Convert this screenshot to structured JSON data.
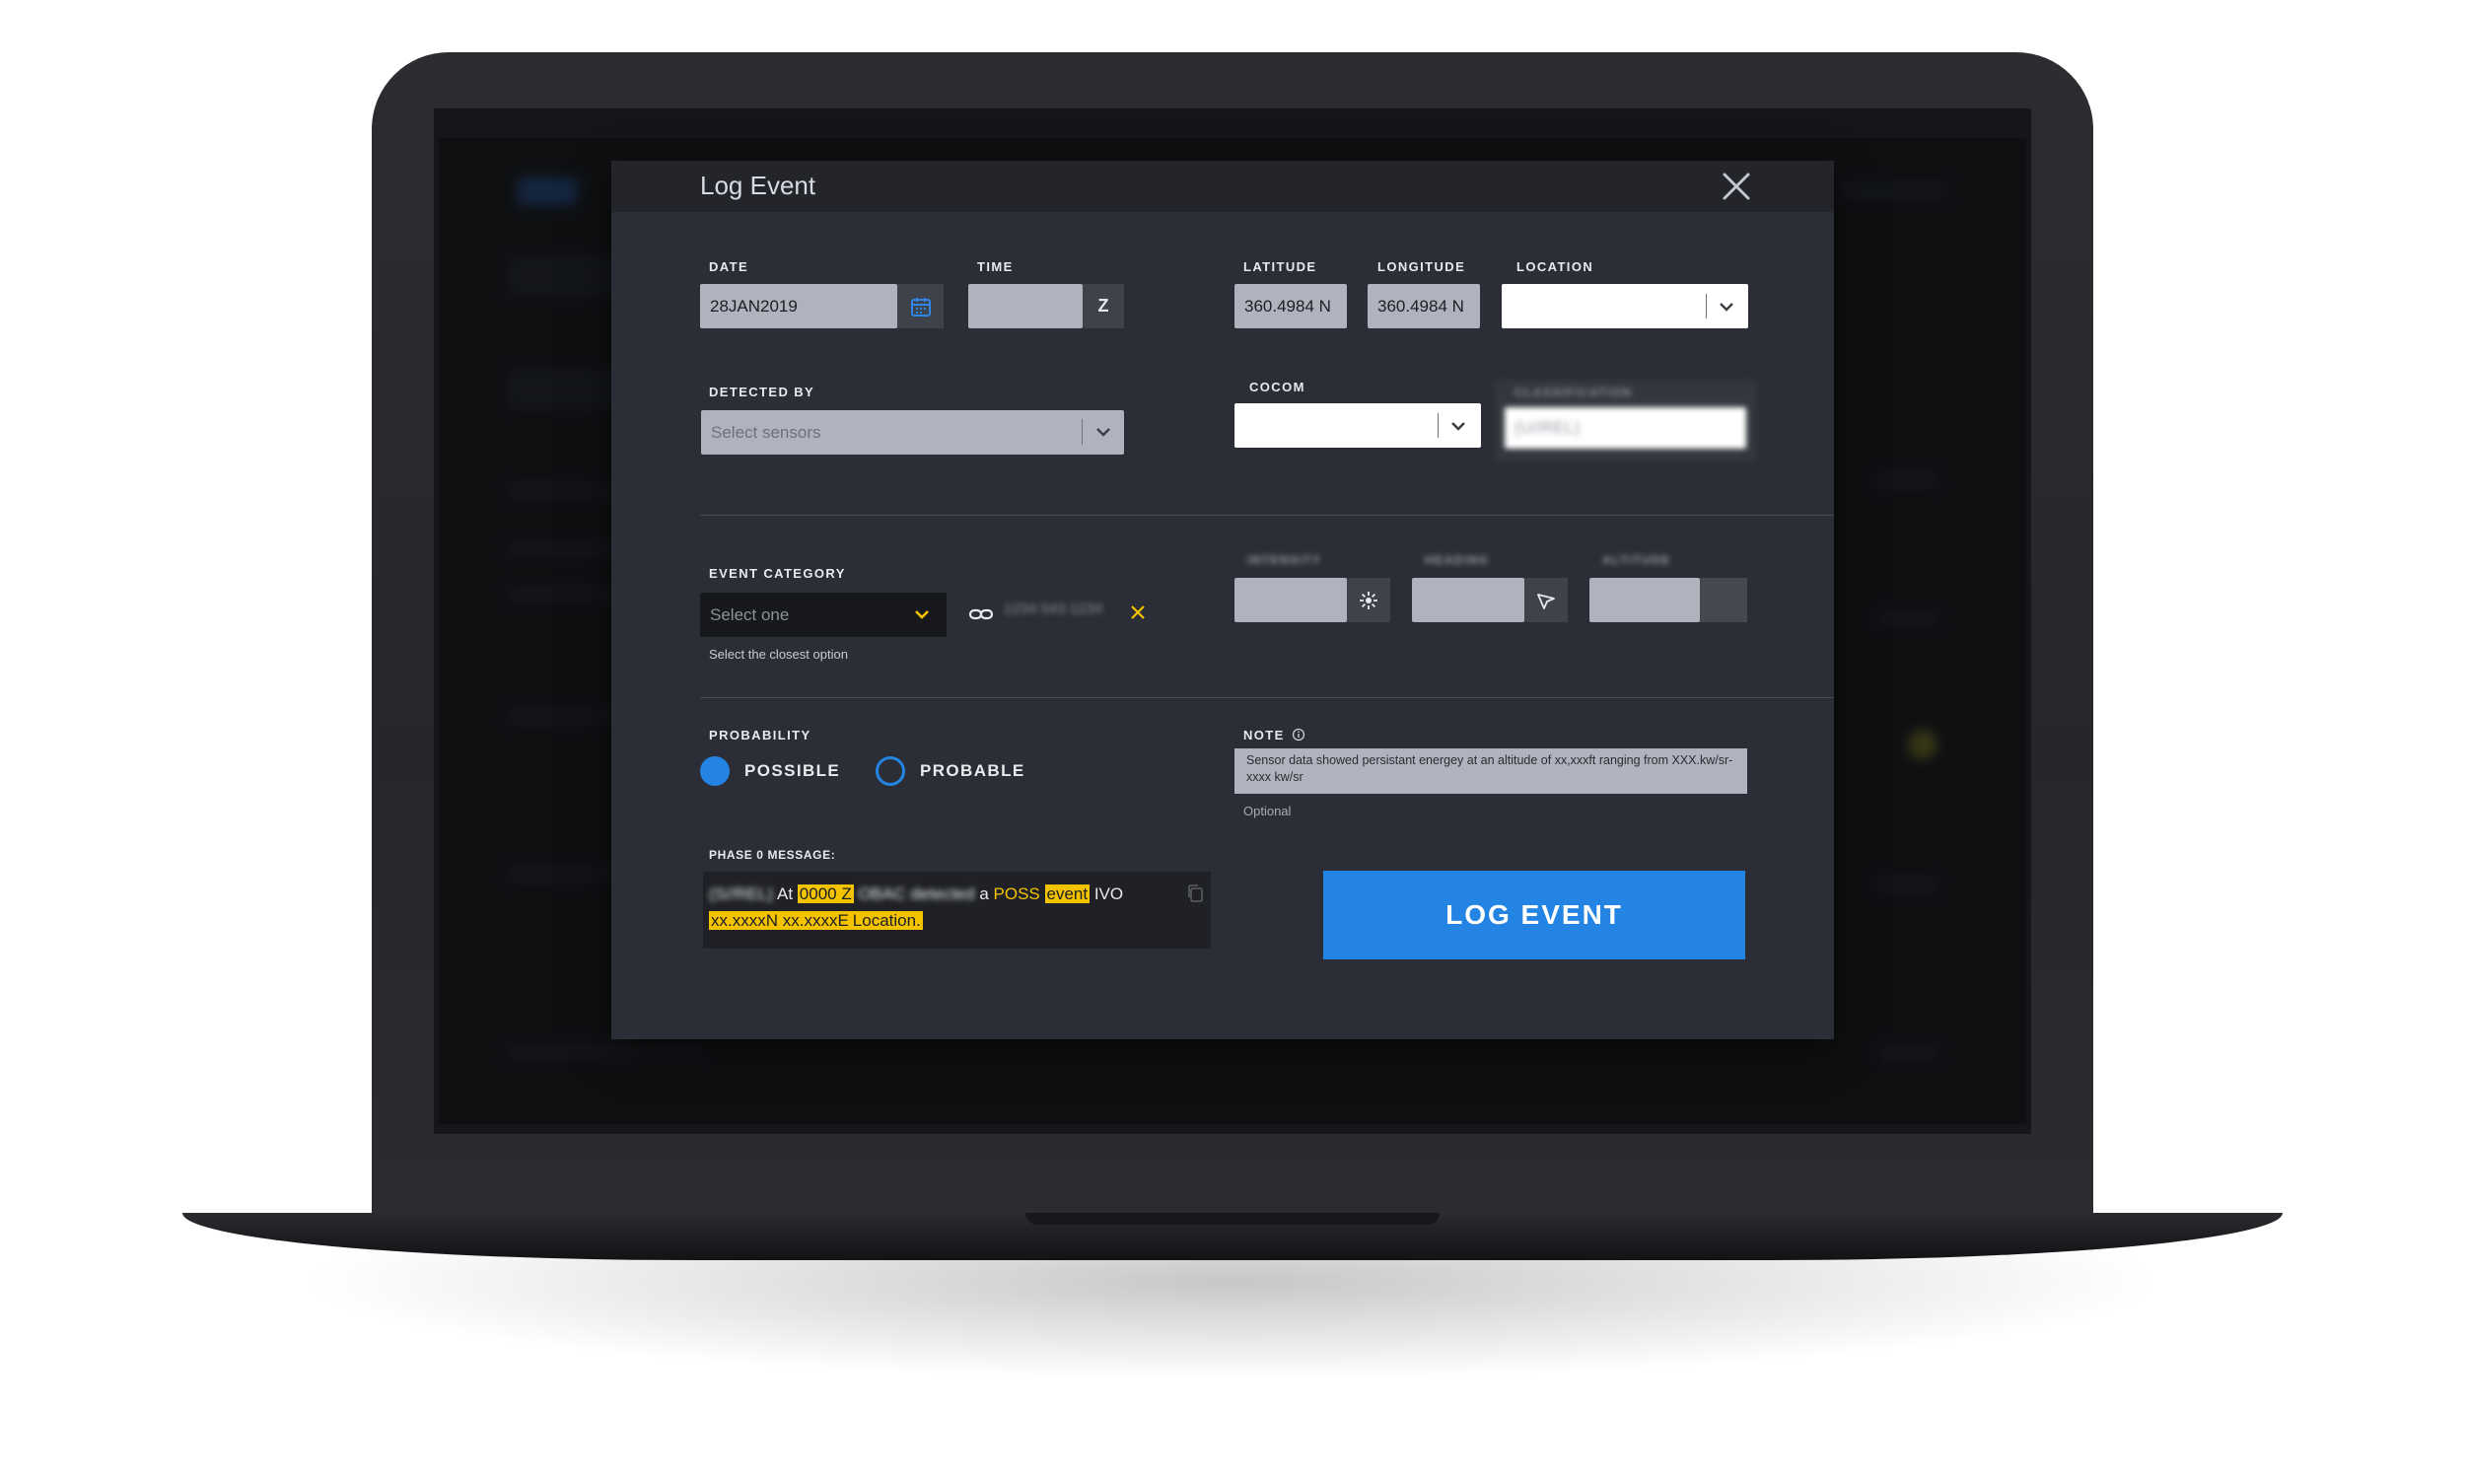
{
  "modal": {
    "title": "Log Event"
  },
  "form": {
    "date": {
      "label": "DATE",
      "value": "28JAN2019"
    },
    "time": {
      "label": "TIME",
      "value": "",
      "suffix": "Z"
    },
    "latitude": {
      "label": "LATITUDE",
      "value": "360.4984 N"
    },
    "longitude": {
      "label": "LONGITUDE",
      "value": "360.4984 N"
    },
    "location": {
      "label": "LOCATION",
      "value": ""
    },
    "detected_by": {
      "label": "DETECTED BY",
      "placeholder": "Select sensors"
    },
    "cocom": {
      "label": "COCOM",
      "value": ""
    },
    "classification": {
      "label": "CLASSIFICATION",
      "value": "(U//REL)"
    },
    "event_category": {
      "label": "EVENT CATEGORY",
      "placeholder": "Select one",
      "hint": "Select the closest option",
      "linked_value": "1234 543 1234"
    },
    "intensity": {
      "label": "INTENSITY"
    },
    "heading": {
      "label": "HEADING"
    },
    "altitude": {
      "label": "ALTITUDE"
    },
    "probability": {
      "label": "PROBABILITY",
      "options": [
        "POSSIBLE",
        "PROBABLE"
      ],
      "selected": "POSSIBLE"
    },
    "note": {
      "label": "NOTE",
      "value": "Sensor data showed persistant energey at  an altitude of xx,xxxft ranging from XXX.kw/sr-xxxx kw/sr",
      "hint": "Optional"
    },
    "phase_message": {
      "label": "PHASE 0 MESSAGE:",
      "parts": {
        "classification": "(S//REL)",
        "at": "At",
        "time": "0000 Z",
        "detected": "OBAC detected",
        "a": "a",
        "poss": "POSS",
        "event": "event",
        "ivo": "IVO",
        "coords": "xx.xxxxN xx.xxxxE",
        "location": "Location."
      }
    },
    "submit_label": "LOG EVENT"
  },
  "colors": {
    "accent": "#2384e3",
    "highlight": "#f4c300",
    "modal_bg": "#2b2e36",
    "field_bg": "#aeb3bd"
  }
}
